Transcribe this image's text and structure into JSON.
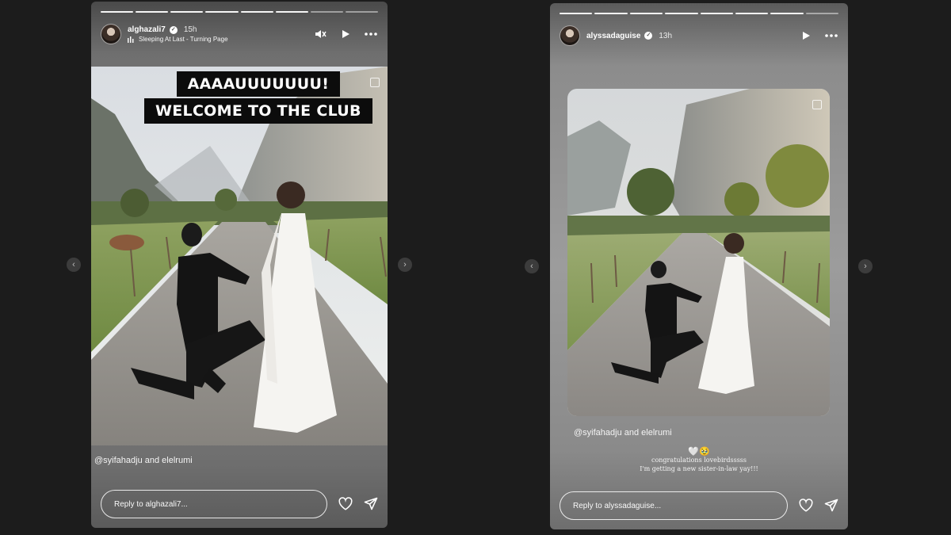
{
  "colors": {
    "page_bg": "#1c1c1c",
    "banner_bg": "#0c0c0c",
    "text": "#ffffff"
  },
  "stories": [
    {
      "username": "alghazali7",
      "time": "15h",
      "music": "Sleeping At Last - Turning Page",
      "banner": {
        "line1": "AAAAUUUUUUU!",
        "line2": "WELCOME TO THE CLUB"
      },
      "caption": "@syifahadju and elelrumi",
      "reply_placeholder": "Reply to alghazali7...",
      "icons": [
        "mute-icon",
        "play-icon",
        "more-icon",
        "heart-icon",
        "send-icon"
      ]
    },
    {
      "username": "alyssadaguise",
      "time": "13h",
      "caption": "@syifahadju and elelrumi",
      "note": {
        "emoji": "🤍🥹",
        "line1": "congratulations lovebirdsssss",
        "line2": "I'm getting a new sister-in-law yay!!!"
      },
      "reply_placeholder": "Reply to alyssadaguise...",
      "icons": [
        "play-icon",
        "more-icon",
        "heart-icon",
        "send-icon"
      ]
    }
  ],
  "nav": {
    "prev": "‹",
    "next": "›"
  }
}
